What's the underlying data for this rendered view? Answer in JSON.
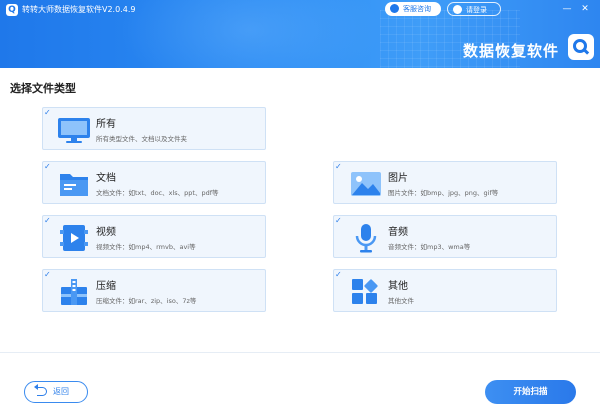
{
  "window": {
    "title": "转转大师数据恢复软件V2.0.4.9",
    "consult_label": "客服咨询",
    "login_label": "请登录",
    "minimize": "—",
    "close": "✕",
    "brand": "数据恢复软件"
  },
  "section": {
    "title": "选择文件类型"
  },
  "cards": {
    "all": {
      "title": "所有",
      "desc": "所有类型文件、文档以及文件夹",
      "checked": true
    },
    "document": {
      "title": "文档",
      "desc": "文档文件：如txt、doc、xls、ppt、pdf等",
      "checked": true
    },
    "image": {
      "title": "图片",
      "desc": "图片文件：如bmp、jpg、png、gif等",
      "checked": true
    },
    "video": {
      "title": "视频",
      "desc": "视频文件：如mp4、rmvb、avi等",
      "checked": true
    },
    "audio": {
      "title": "音频",
      "desc": "音频文件：如mp3、wma等",
      "checked": true
    },
    "archive": {
      "title": "压缩",
      "desc": "压缩文件：如rar、zip、iso、7z等",
      "checked": true
    },
    "other": {
      "title": "其他",
      "desc": "其他文件",
      "checked": true
    }
  },
  "check_glyph": "✓",
  "footer": {
    "back_label": "返回",
    "start_label": "开始扫描"
  },
  "colors": {
    "accent": "#2b7de9",
    "card_bg": "#f0f6fd",
    "card_border": "#cfe1f5"
  }
}
